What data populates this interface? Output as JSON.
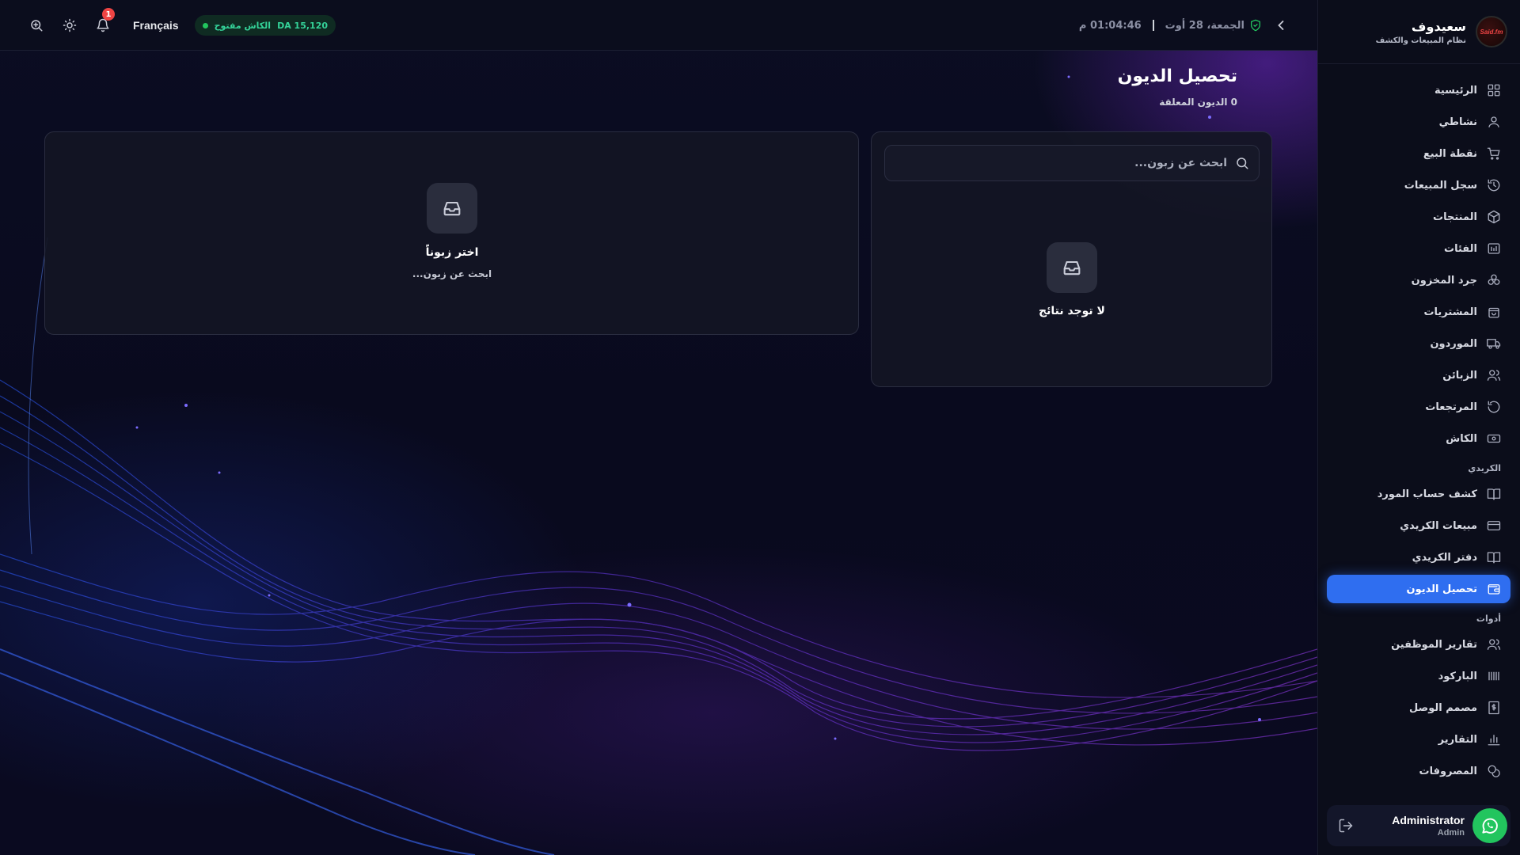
{
  "topbar": {
    "language": "Français",
    "cash_status": "الكاش مفتوح",
    "cash_amount": "DA 15,120",
    "notification_count": "1",
    "date": "الجمعة، 28 أوت",
    "time": "01:04:46 م"
  },
  "brand": {
    "name": "سعيدوف",
    "subtitle": "نظام المبيعات والكشف",
    "logo_text": "Said.fm"
  },
  "nav": {
    "items": [
      {
        "label": "الرئيسية",
        "icon": "grid-icon"
      },
      {
        "label": "نشاطي",
        "icon": "user-icon"
      },
      {
        "label": "نقطة البيع",
        "icon": "cart-icon"
      },
      {
        "label": "سجل المبيعات",
        "icon": "history-icon"
      },
      {
        "label": "المنتجات",
        "icon": "box-icon"
      },
      {
        "label": "الفئات",
        "icon": "category-icon"
      },
      {
        "label": "جرد المخزون",
        "icon": "stack-icon"
      },
      {
        "label": "المشتريات",
        "icon": "bag-icon"
      },
      {
        "label": "الموردون",
        "icon": "truck-icon"
      },
      {
        "label": "الزبائن",
        "icon": "users-icon"
      },
      {
        "label": "المرتجعات",
        "icon": "return-icon"
      },
      {
        "label": "الكاش",
        "icon": "cash-icon"
      }
    ],
    "section_credit": "الكريدي",
    "credit_items": [
      {
        "label": "كشف حساب المورد",
        "icon": "book-icon"
      },
      {
        "label": "مبيعات الكريدي",
        "icon": "card-icon"
      },
      {
        "label": "دفتر الكريدي",
        "icon": "book-open-icon"
      },
      {
        "label": "تحصيل الديون",
        "icon": "wallet-icon"
      }
    ],
    "section_tools": "أدوات",
    "tool_items": [
      {
        "label": "تقارير الموظفين",
        "icon": "team-icon"
      },
      {
        "label": "الباركود",
        "icon": "barcode-icon"
      },
      {
        "label": "مصمم الوصل",
        "icon": "receipt-icon"
      },
      {
        "label": "التقارير",
        "icon": "chart-icon"
      },
      {
        "label": "المصروفات",
        "icon": "coins-icon"
      }
    ]
  },
  "user": {
    "name": "Administrator",
    "role": "Admin"
  },
  "page": {
    "title": "تحصيل الديون",
    "subtitle": "0 الديون المعلقة"
  },
  "search": {
    "placeholder": "ابحث عن زبون..."
  },
  "results_panel": {
    "empty_title": "لا توجد نتائج"
  },
  "detail_panel": {
    "empty_title": "اختر زبوناً",
    "empty_subtitle": "ابحث عن زبون..."
  },
  "colors": {
    "accent": "#2f6ef0",
    "cash_open": "#34d399",
    "notification": "#ef4444",
    "whatsapp": "#22c55e"
  }
}
